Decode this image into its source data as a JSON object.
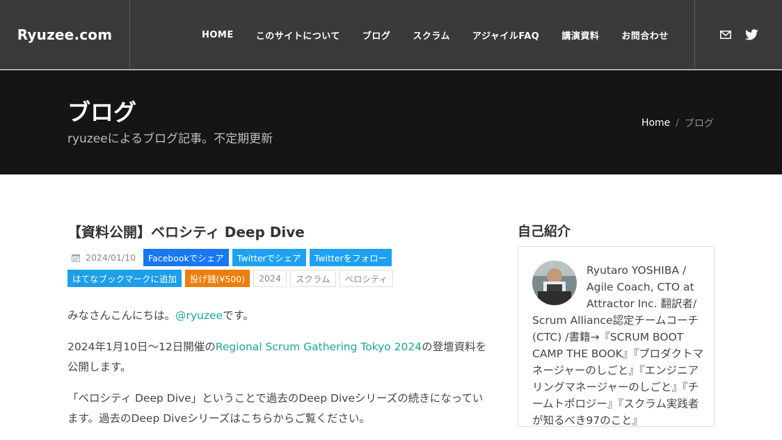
{
  "site": {
    "logo": "Ryuzee.com",
    "nav": [
      "HOME",
      "このサイトについて",
      "ブログ",
      "スクラム",
      "アジャイルFAQ",
      "講演資料",
      "お問合わせ"
    ],
    "social": [
      "mail-icon",
      "twitter-icon"
    ]
  },
  "hero": {
    "title": "ブログ",
    "subtitle": "ryuzeeによるブログ記事。不定期更新",
    "breadcrumb": {
      "home": "Home",
      "separator": "/",
      "current": "ブログ"
    }
  },
  "article": {
    "title": "【資料公開】ベロシティ Deep Dive",
    "date": "2024/01/10",
    "buttons": {
      "facebook": "Facebookでシェア",
      "twitter_share": "Twitterでシェア",
      "twitter_follow": "Twitterをフォロー",
      "hatena": "はてなブックマークに追加",
      "tip": "投げ銭(¥500)"
    },
    "tags": [
      "2024",
      "スクラム",
      "ベロシティ"
    ],
    "p1_before": "みなさんこんにちは。",
    "p1_link": "@ryuzee",
    "p1_after": "です。",
    "p2_before": "2024年1月10日〜12日開催の",
    "p2_link": "Regional Scrum Gathering Tokyo 2024",
    "p2_after": "の登壇資料を公開します。",
    "p3": "「ベロシティ Deep Dive」ということで過去のDeep Diveシリーズの続きになっています。過去のDeep Diveシリーズはこちらからご覧ください。"
  },
  "sidebar": {
    "title": "自己紹介",
    "profile": "Ryutaro YOSHIBA / Agile Coach, CTO at Attractor Inc. 翻訳者/ Scrum Alliance認定チームコーチ(CTC) /書籍→『SCRUM BOOT CAMP THE BOOK』『プロダクトマネージャーのしごと』『エンジニアリングマネージャーのしごと』『チームトポロジー』『スクラム実践者が知るべき97のこと』"
  },
  "colors": {
    "header_bg": "#3a3a3a",
    "hero_bg": "#151515",
    "link": "#1aa59a",
    "facebook": "#1877f2",
    "twitter": "#1da1f2",
    "tip": "#ee7e0b"
  }
}
